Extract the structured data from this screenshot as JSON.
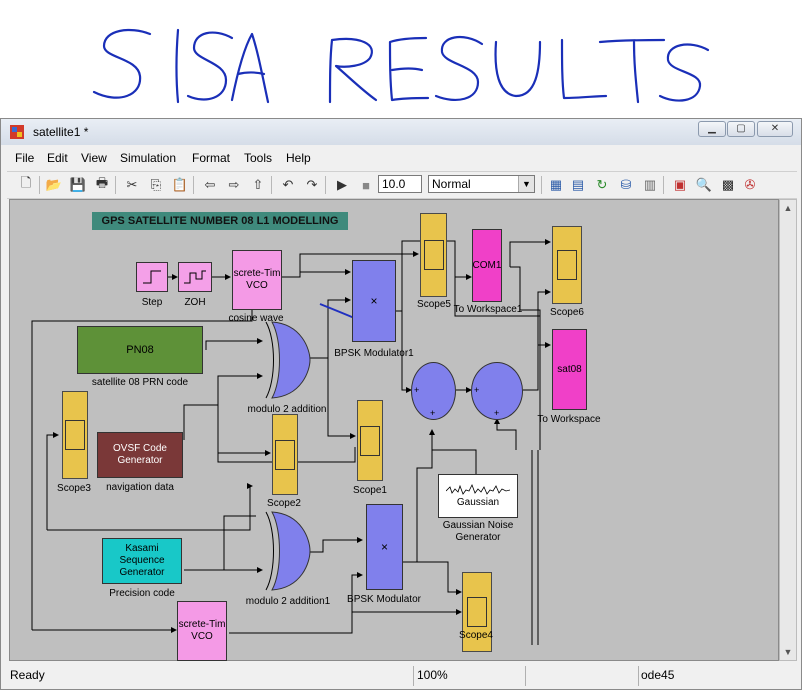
{
  "handwriting": {
    "text": "SISA RESULTS"
  },
  "window": {
    "title": "satellite1 *",
    "controls": {
      "minimize": "minimize-icon",
      "maximize": "maximize-icon",
      "close": "close-icon"
    }
  },
  "menu": [
    "File",
    "Edit",
    "View",
    "Simulation",
    "Format",
    "Tools",
    "Help"
  ],
  "toolbar": {
    "stop_time": "10.0",
    "sim_mode": "Normal",
    "icons": [
      "new-model-icon",
      "open-icon",
      "save-icon",
      "print-icon",
      "cut-icon",
      "copy-icon",
      "paste-icon",
      "back-icon",
      "forward-icon",
      "up-icon",
      "undo-icon",
      "redo-icon",
      "start-simulation-icon",
      "stop-simulation-icon",
      "library-browser-icon",
      "model-explorer-icon",
      "update-diagram-icon",
      "build-icon",
      "debug-icon",
      "library-icon",
      "model-advisor-icon",
      "explorer-icon",
      "profiler-icon"
    ]
  },
  "diagram": {
    "heading": "GPS SATELLITE NUMBER 08 L1 MODELLING",
    "blocks": {
      "step": "Step",
      "zoh": "ZOH",
      "vco1": {
        "text": "screte-Tim\nVCO",
        "label": "cosine wave"
      },
      "bpsk1": {
        "text": "×",
        "label": "BPSK Modulator1"
      },
      "scope5": "Scope5",
      "com1": {
        "text": "COM1",
        "label": "To Workspace1"
      },
      "scope6": "Scope6",
      "pn08": {
        "text": "PN08",
        "label": "satellite 08 PRN code"
      },
      "xor1": "modulo 2 addition",
      "sat08": {
        "text": "sat08",
        "label": "To Workspace"
      },
      "scope3": "Scope3",
      "ovsf": {
        "text": "OVSF Code\nGenerator",
        "label": "navigation data"
      },
      "scope2": "Scope2",
      "scope1": "Scope1",
      "gaussian": {
        "text": "Gaussian",
        "label": "Gaussian Noise\nGenerator"
      },
      "kasami": {
        "text": "Kasami\nSequence\nGenerator",
        "label": "Precision code"
      },
      "xor2": "modulo 2 addition1",
      "bpsk2": {
        "text": "×",
        "label": "BPSK Modulator"
      },
      "scope4": "Scope4",
      "vco2": {
        "text": "screte-Tim\nVCO"
      },
      "sum_sign": "+"
    }
  },
  "status": {
    "left": "Ready",
    "zoom": "100%",
    "solver": "ode45"
  }
}
